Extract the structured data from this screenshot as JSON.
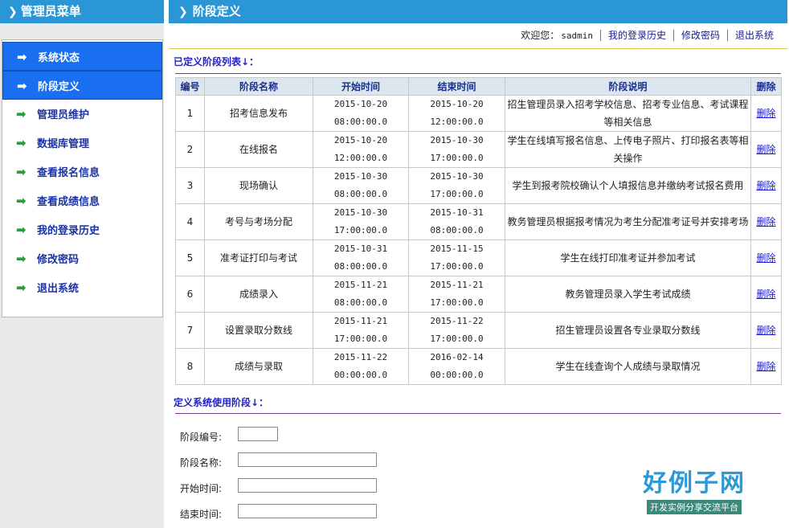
{
  "sidebar": {
    "title": "管理员菜单",
    "items": [
      {
        "label": "系统状态",
        "active": true
      },
      {
        "label": "阶段定义",
        "active": true
      },
      {
        "label": "管理员维护",
        "active": false
      },
      {
        "label": "数据库管理",
        "active": false
      },
      {
        "label": "查看报名信息",
        "active": false
      },
      {
        "label": "查看成绩信息",
        "active": false
      },
      {
        "label": "我的登录历史",
        "active": false
      },
      {
        "label": "修改密码",
        "active": false
      },
      {
        "label": "退出系统",
        "active": false
      }
    ]
  },
  "main": {
    "title": "阶段定义",
    "welcome": "欢迎您：",
    "username": "sadmin",
    "links": [
      "我的登录历史",
      "修改密码",
      "退出系统"
    ],
    "list_heading": "已定义阶段列表↓：",
    "columns": [
      "编号",
      "阶段名称",
      "开始时间",
      "结束时间",
      "阶段说明",
      "删除"
    ],
    "rows": [
      {
        "id": "1",
        "name": "招考信息发布",
        "start_date": "2015-10-20",
        "start_time": "08:00:00.0",
        "end_date": "2015-10-20",
        "end_time": "12:00:00.0",
        "desc": "招生管理员录入招考学校信息、招考专业信息、考试课程等相关信息",
        "del": "删除"
      },
      {
        "id": "2",
        "name": "在线报名",
        "start_date": "2015-10-20",
        "start_time": "12:00:00.0",
        "end_date": "2015-10-30",
        "end_time": "17:00:00.0",
        "desc": "学生在线填写报名信息、上传电子照片、打印报名表等相关操作",
        "del": "删除"
      },
      {
        "id": "3",
        "name": "现场确认",
        "start_date": "2015-10-30",
        "start_time": "08:00:00.0",
        "end_date": "2015-10-30",
        "end_time": "17:00:00.0",
        "desc": "学生到报考院校确认个人填报信息并缴纳考试报名费用",
        "del": "删除"
      },
      {
        "id": "4",
        "name": "考号与考场分配",
        "start_date": "2015-10-30",
        "start_time": "17:00:00.0",
        "end_date": "2015-10-31",
        "end_time": "08:00:00.0",
        "desc": "教务管理员根据报考情况为考生分配准考证号并安排考场",
        "del": "删除"
      },
      {
        "id": "5",
        "name": "准考证打印与考试",
        "start_date": "2015-10-31",
        "start_time": "08:00:00.0",
        "end_date": "2015-11-15",
        "end_time": "17:00:00.0",
        "desc": "学生在线打印准考证并参加考试",
        "del": "删除"
      },
      {
        "id": "6",
        "name": "成绩录入",
        "start_date": "2015-11-21",
        "start_time": "08:00:00.0",
        "end_date": "2015-11-21",
        "end_time": "17:00:00.0",
        "desc": "教务管理员录入学生考试成绩",
        "del": "删除"
      },
      {
        "id": "7",
        "name": "设置录取分数线",
        "start_date": "2015-11-21",
        "start_time": "17:00:00.0",
        "end_date": "2015-11-22",
        "end_time": "17:00:00.0",
        "desc": "招生管理员设置各专业录取分数线",
        "del": "删除"
      },
      {
        "id": "8",
        "name": "成绩与录取",
        "start_date": "2015-11-22",
        "start_time": "00:00:00.0",
        "end_date": "2016-02-14",
        "end_time": "00:00:00.0",
        "desc": "学生在线查询个人成绩与录取情况",
        "del": "删除"
      }
    ],
    "form_heading": "定义系统使用阶段↓：",
    "form": {
      "id_label": "阶段编号:",
      "name_label": "阶段名称:",
      "start_label": "开始时间:",
      "end_label": "结束时间:"
    }
  },
  "watermark": {
    "brand": "好例子网",
    "tagline": "开发实例分享交流平台"
  }
}
